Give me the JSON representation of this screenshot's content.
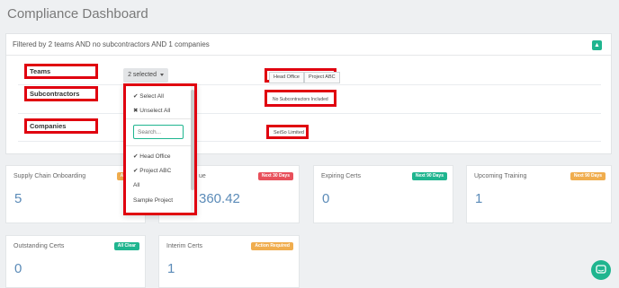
{
  "page": {
    "title": "Compliance Dashboard"
  },
  "filter": {
    "summary": "Filtered by 2 teams AND no subcontractors AND 1 companies",
    "rows": [
      {
        "label": "Teams",
        "tags": [
          "Head Office",
          "Project ABC"
        ]
      },
      {
        "label": "Subcontractors",
        "tags": [
          "No Subcontractors Included"
        ]
      },
      {
        "label": "Companies",
        "tags": [
          "SeiSo Limited"
        ]
      }
    ],
    "dropdown": {
      "button_label": "2 selected",
      "select_all": "Select All",
      "unselect_all": "Unselect All",
      "search_placeholder": "Search...",
      "options": [
        {
          "label": "Head Office",
          "checked": true
        },
        {
          "label": "Project ABC",
          "checked": true
        },
        {
          "label": "All",
          "checked": false
        },
        {
          "label": "Sample Project",
          "checked": false
        }
      ]
    }
  },
  "cards": [
    {
      "title": "Supply Chain Onboarding",
      "value": "5",
      "badge": "Action Re",
      "badge_color": "#f0ad4e"
    },
    {
      "title": "ue",
      "value": "360.42",
      "badge": "Next 30 Days",
      "badge_color": "#e8505b"
    },
    {
      "title": "Expiring Certs",
      "value": "0",
      "badge": "Next 90 Days",
      "badge_color": "#1fb58f"
    },
    {
      "title": "Upcoming Training",
      "value": "1",
      "badge": "Next 90 Days",
      "badge_color": "#f0ad4e"
    },
    {
      "title": "Outstanding Certs",
      "value": "0",
      "badge": "All Clear",
      "badge_color": "#1fb58f"
    },
    {
      "title": "Interim Certs",
      "value": "1",
      "badge": "Action Required",
      "badge_color": "#f0ad4e"
    }
  ],
  "colors": {
    "accent": "#1fb58f",
    "highlight": "#e0000f",
    "value": "#5b8bb8"
  },
  "icons": {
    "collapse": "chevron-up-icon",
    "chat": "chat-icon"
  }
}
